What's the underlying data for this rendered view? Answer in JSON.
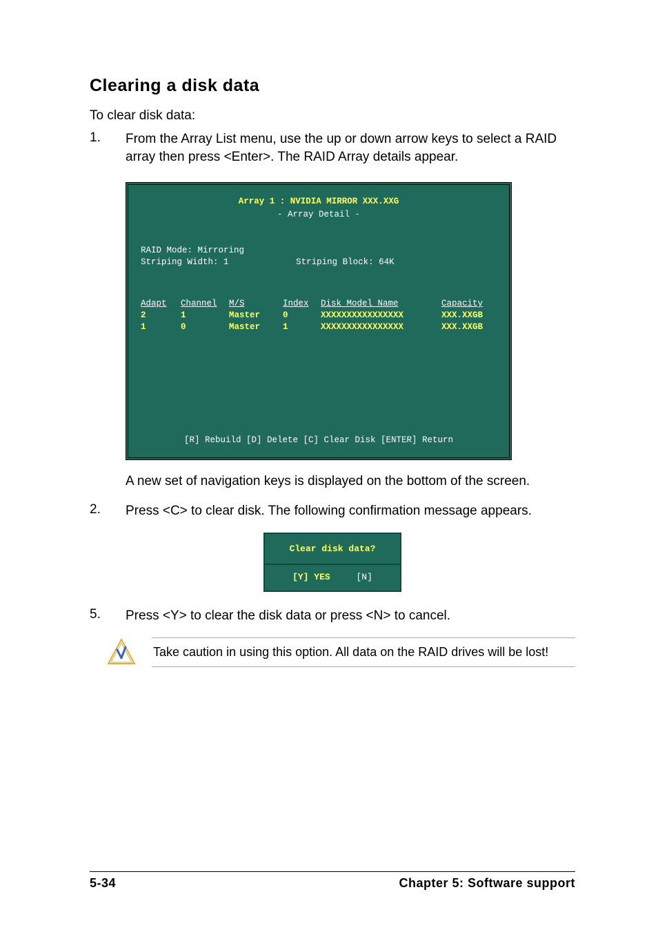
{
  "title": "Clearing a disk data",
  "lead": "To clear disk data:",
  "steps": [
    {
      "num": "1.",
      "text": "From the Array List menu, use the up or down arrow keys to select a RAID array then press <Enter>. The RAID Array details appear."
    },
    {
      "num_note": "",
      "note": "A new set of  navigation keys is displayed on the bottom of the screen."
    },
    {
      "num": "2.",
      "text": "Press <C> to clear disk. The following confirmation message appears."
    },
    {
      "num": "5.",
      "text": "Press <Y> to clear the disk data or press <N> to cancel."
    }
  ],
  "bios": {
    "title_line": "Array 1 : NVIDIA MIRROR  XXX.XXG",
    "subtitle": "- Array Detail -",
    "raid_mode": "RAID Mode: Mirroring",
    "striping_width": "Striping Width: 1",
    "striping_block": "Striping Block: 64K",
    "columns": {
      "adapt": "Adapt",
      "channel": "Channel",
      "ms": "M/S",
      "index": "Index",
      "model": "Disk Model Name",
      "capacity": "Capacity"
    },
    "rows": [
      {
        "adapt": "2",
        "channel": "1",
        "ms": "Master",
        "index": "0",
        "model": "XXXXXXXXXXXXXXXX",
        "capacity": "XXX.XXGB"
      },
      {
        "adapt": "1",
        "channel": "0",
        "ms": "Master",
        "index": "1",
        "model": "XXXXXXXXXXXXXXXX",
        "capacity": "XXX.XXGB"
      }
    ],
    "footer": "[R] Rebuild  [D] Delete  [C] Clear Disk  [ENTER] Return"
  },
  "confirm": {
    "question": "Clear disk data?",
    "yes": "[Y] YES",
    "no": "[N]"
  },
  "caution": "Take caution in using this option. All data on the RAID drives will be lost!",
  "footer": {
    "page": "5-34",
    "chapter": "Chapter 5: Software support"
  }
}
